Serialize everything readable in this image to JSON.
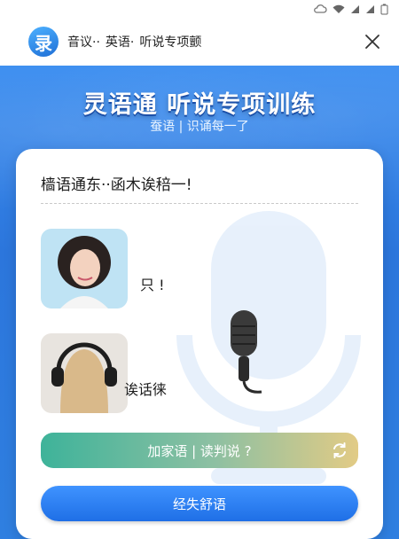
{
  "status": {
    "icons": [
      "cloud-icon",
      "wifi-icon",
      "signal-icon",
      "signal-icon",
      "battery-icon"
    ]
  },
  "header": {
    "logo_char": "录",
    "breadcrumb": [
      "音议··",
      "英语·",
      "听说专项颤"
    ],
    "close_icon": "close-icon"
  },
  "hero": {
    "title": "灵语通 听说专项训练",
    "subtitle": "蚕语 | 识诵每一了"
  },
  "card": {
    "prompt": "樯语通东··函木诶稖一!",
    "item1_text": "只  !",
    "item2_text": "诶话徕",
    "action_label": "加家语 | 读判说 ?",
    "primary_label": "经失舒语"
  },
  "colors": {
    "accent": "#2f7fe0",
    "pill_start": "#3eb39a",
    "pill_end": "#e2cb85",
    "button": "#1f6fe6"
  }
}
